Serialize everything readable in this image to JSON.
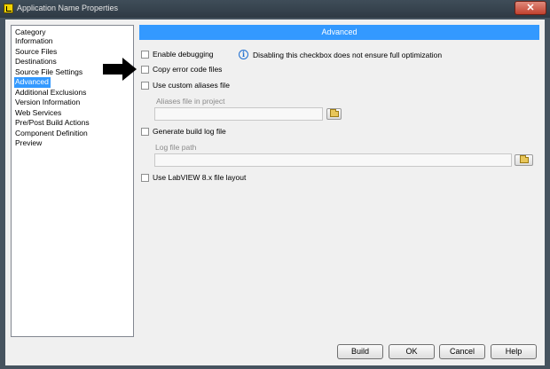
{
  "window": {
    "title": "Application Name Properties",
    "close_label": "✕"
  },
  "category": {
    "header": "Category",
    "items": [
      "Information",
      "Source Files",
      "Destinations",
      "Source File Settings",
      "Advanced",
      "Additional Exclusions",
      "Version Information",
      "Web Services",
      "Pre/Post Build Actions",
      "Component Definition",
      "Preview"
    ],
    "selected": "Advanced"
  },
  "advanced": {
    "header": "Advanced",
    "enable_debugging": {
      "label": "Enable debugging",
      "checked": false
    },
    "info_note": "Disabling this checkbox does not ensure full optimization",
    "copy_error_code_files": {
      "label": "Copy error code files",
      "checked": false
    },
    "use_custom_aliases": {
      "label": "Use custom aliases file",
      "checked": false
    },
    "aliases_file_label": "Aliases file in project",
    "aliases_file_value": "",
    "generate_build_log": {
      "label": "Generate build log file",
      "checked": false
    },
    "log_file_label": "Log file path",
    "log_file_value": "",
    "use_labview8x_layout": {
      "label": "Use LabVIEW 8.x file layout",
      "checked": false
    }
  },
  "buttons": {
    "build": "Build",
    "ok": "OK",
    "cancel": "Cancel",
    "help": "Help"
  },
  "colors": {
    "accent": "#3399ff",
    "titlebar": "#2f3a44",
    "arrow": "#000000"
  },
  "icons": {
    "app": "labview-app-icon",
    "info": "info-icon",
    "folder": "folder-icon",
    "arrow": "black-arrow-icon"
  }
}
